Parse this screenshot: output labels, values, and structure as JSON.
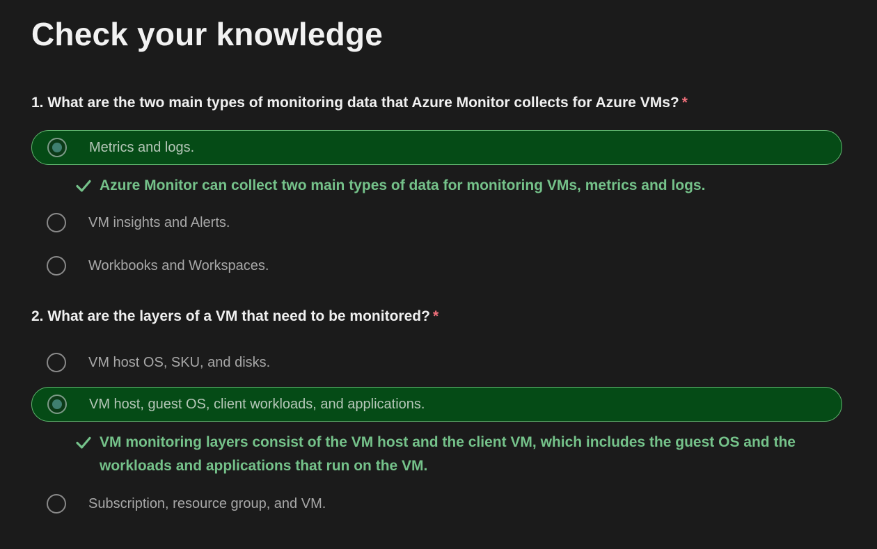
{
  "title": "Check your knowledge",
  "questions": [
    {
      "text": "1. What are the two main types of monitoring data that Azure Monitor collects for Azure VMs?",
      "required_mark": "*",
      "options": [
        {
          "label": "Metrics and logs.",
          "selected": true
        },
        {
          "label": "VM insights and Alerts.",
          "selected": false
        },
        {
          "label": "Workbooks and Workspaces.",
          "selected": false
        }
      ],
      "feedback": "Azure Monitor can collect two main types of data for monitoring VMs, metrics and logs."
    },
    {
      "text": "2. What are the layers of a VM that need to be monitored?",
      "required_mark": "*",
      "options": [
        {
          "label": "VM host OS, SKU, and disks.",
          "selected": false
        },
        {
          "label": "VM host, guest OS, client workloads, and applications.",
          "selected": true
        },
        {
          "label": "Subscription, resource group, and VM.",
          "selected": false
        }
      ],
      "feedback": "VM monitoring layers consist of the VM host and the client VM, which includes the guest OS and the workloads and applications that run on the VM."
    }
  ],
  "colors": {
    "background": "#1b1b1b",
    "selected_fill": "#054b16",
    "selected_border": "#5fb46e",
    "feedback_text": "#75c28a",
    "required_mark": "#f1707b"
  },
  "icons": {
    "correct": "check-icon",
    "radio": "radio-button-icon"
  }
}
